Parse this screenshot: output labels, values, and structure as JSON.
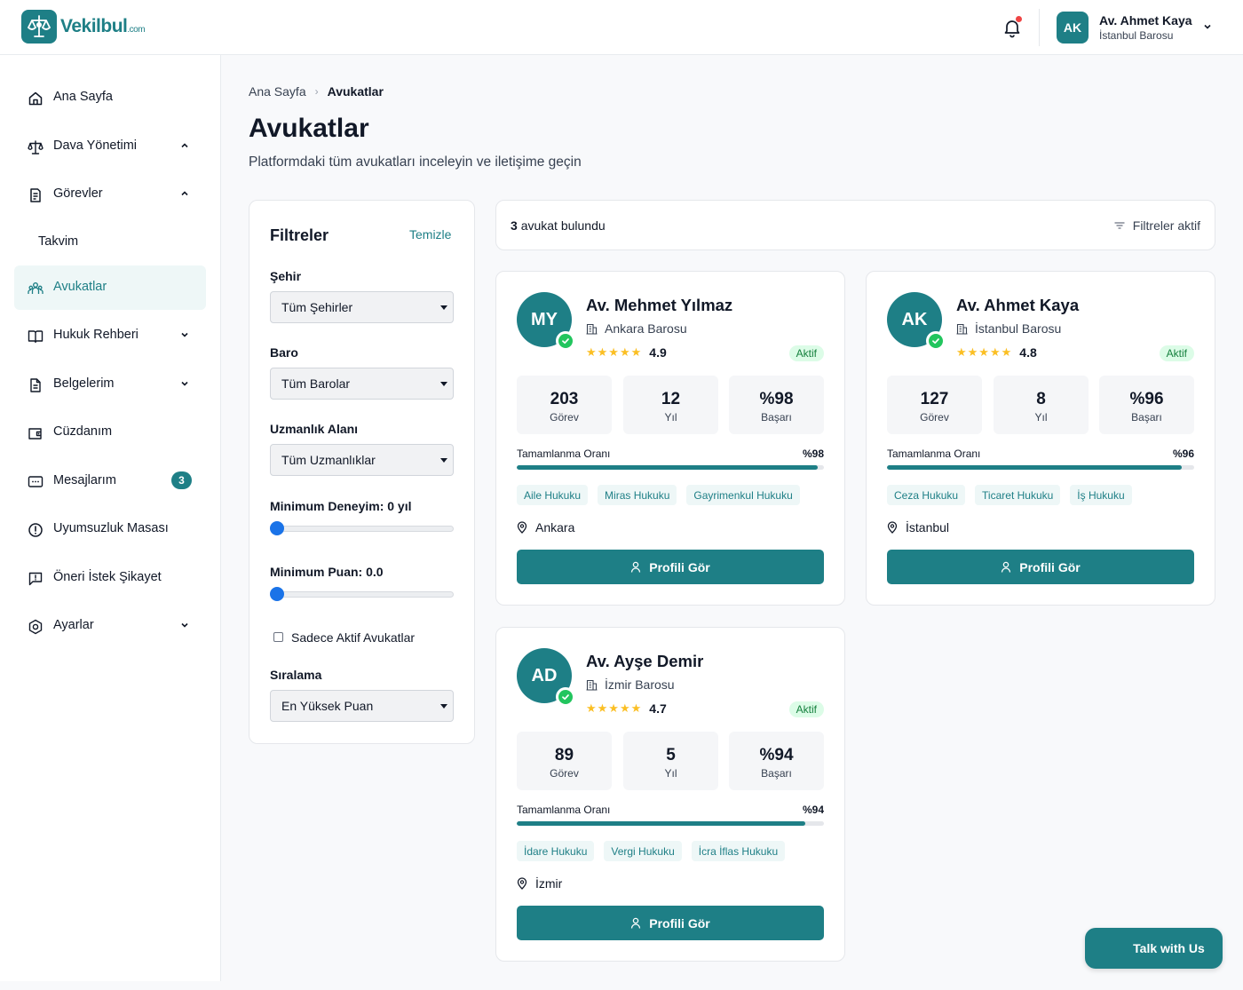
{
  "app": {
    "logo_text": "Vekilbul",
    "logo_suffix": ".com"
  },
  "header": {
    "user_initials": "AK",
    "user_name": "Av. Ahmet Kaya",
    "user_bar": "İstanbul Barosu"
  },
  "sidebar": {
    "items": [
      {
        "label": "Ana Sayfa",
        "icon": "home-icon"
      },
      {
        "label": "Dava Yönetimi",
        "icon": "scale-icon",
        "expanded": true
      },
      {
        "label": "Görevler",
        "icon": "task-icon",
        "expanded": true
      },
      {
        "label": "Takvim"
      },
      {
        "label": "Avukatlar",
        "icon": "users-icon",
        "active": true
      },
      {
        "label": "Hukuk Rehberi",
        "icon": "book-icon"
      },
      {
        "label": "Belgelerim",
        "icon": "document-icon"
      },
      {
        "label": "Cüzdanım",
        "icon": "wallet-icon"
      },
      {
        "label": "Mesajlarım",
        "icon": "message-icon",
        "badge": "3"
      },
      {
        "label": "Uyumsuzluk Masası",
        "icon": "alert-icon"
      },
      {
        "label": "Öneri İstek Şikayet",
        "icon": "feedback-icon"
      },
      {
        "label": "Ayarlar",
        "icon": "settings-icon"
      }
    ]
  },
  "breadcrumb": {
    "home": "Ana Sayfa",
    "current": "Avukatlar"
  },
  "page": {
    "title": "Avukatlar",
    "subtitle": "Platformdaki tüm avukatları inceleyin ve iletişime geçin"
  },
  "filters": {
    "title": "Filtreler",
    "clear_label": "Temizle",
    "city_label": "Şehir",
    "city_value": "Tüm Şehirler",
    "bar_label": "Baro",
    "bar_value": "Tüm Barolar",
    "specialty_label": "Uzmanlık Alanı",
    "specialty_value": "Tüm Uzmanlıklar",
    "min_experience_label": "Minimum Deneyim: 0 yıl",
    "min_experience_fraction": 0,
    "min_rating_label": "Minimum Puan: 0.0",
    "min_rating_fraction": 0,
    "active_only_label": "Sadece Aktif Avukatlar",
    "active_only_checked": false,
    "sort_label": "Sıralama",
    "sort_value": "En Yüksek Puan"
  },
  "results": {
    "count": "3",
    "count_suffix": "avukat bulundu",
    "filters_active": "Filtreler aktif"
  },
  "lawyers": [
    {
      "initials": "MY",
      "name": "Av. Mehmet Yılmaz",
      "bar": "Ankara Barosu",
      "stars": "★★★★★",
      "rating": "4.9",
      "status": "Aktif",
      "tasks": "203",
      "tasks_label": "Görev",
      "years": "12",
      "years_label": "Yıl",
      "success": "%98",
      "success_label": "Başarı",
      "completion_label": "Tamamlanma Oranı",
      "completion_value": "%98",
      "completion_percent": 98,
      "tags": [
        "Aile Hukuku",
        "Miras Hukuku",
        "Gayrimenkul Hukuku"
      ],
      "city": "Ankara",
      "button": "Profili Gör"
    },
    {
      "initials": "AK",
      "name": "Av. Ahmet Kaya",
      "bar": "İstanbul Barosu",
      "stars": "★★★★★",
      "rating": "4.8",
      "status": "Aktif",
      "tasks": "127",
      "tasks_label": "Görev",
      "years": "8",
      "years_label": "Yıl",
      "success": "%96",
      "success_label": "Başarı",
      "completion_label": "Tamamlanma Oranı",
      "completion_value": "%96",
      "completion_percent": 96,
      "tags": [
        "Ceza Hukuku",
        "Ticaret Hukuku",
        "İş Hukuku"
      ],
      "city": "İstanbul",
      "button": "Profili Gör"
    },
    {
      "initials": "AD",
      "name": "Av. Ayşe Demir",
      "bar": "İzmir Barosu",
      "stars": "★★★★★",
      "rating": "4.7",
      "status": "Aktif",
      "tasks": "89",
      "tasks_label": "Görev",
      "years": "5",
      "years_label": "Yıl",
      "success": "%94",
      "success_label": "Başarı",
      "completion_label": "Tamamlanma Oranı",
      "completion_value": "%94",
      "completion_percent": 94,
      "tags": [
        "İdare Hukuku",
        "Vergi Hukuku",
        "İcra İflas Hukuku"
      ],
      "city": "İzmir",
      "button": "Profili Gör"
    }
  ],
  "chat": {
    "label": "Talk with Us"
  },
  "colors": {
    "primary": "#1e7f86",
    "success": "#22c55e",
    "star": "#fbbf24",
    "notification": "#ef4444"
  }
}
